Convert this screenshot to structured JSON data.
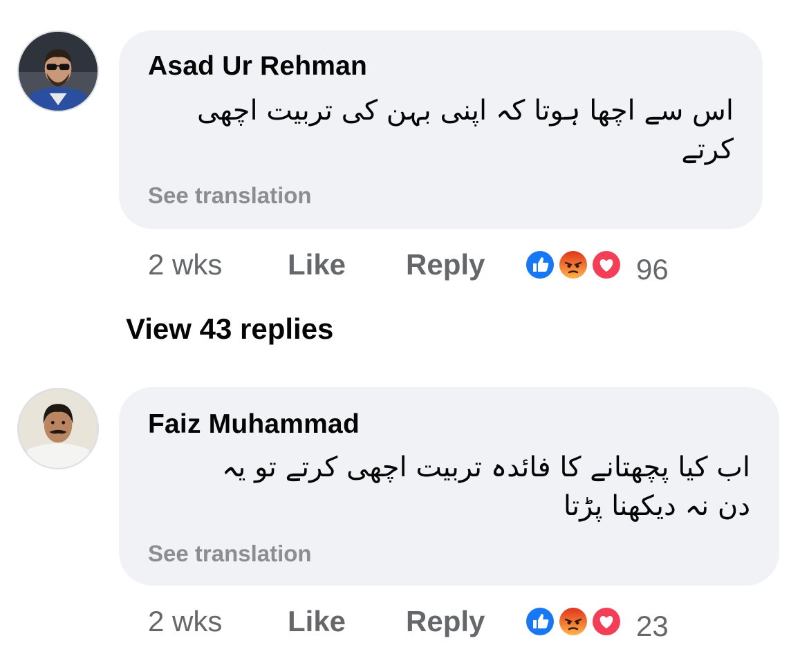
{
  "comments": [
    {
      "author": "Asad Ur Rehman",
      "text": "اس سے اچھا ہوتا کہ اپنی بہن کی تربیت اچھی\nکرتے",
      "see_translation": "See translation",
      "time": "2 wks",
      "like_label": "Like",
      "reply_label": "Reply",
      "reaction_count": "96",
      "reactions": [
        "like-icon",
        "angry-icon",
        "love-icon"
      ]
    },
    {
      "author": "Faiz Muhammad",
      "text": "اب کیا پچھتانے کا فائدہ تربیت اچھی کرتے تو یہ\nدن نہ دیکھنا پڑتا",
      "see_translation": "See translation",
      "time": "2 wks",
      "like_label": "Like",
      "reply_label": "Reply",
      "reaction_count": "23",
      "reactions": [
        "like-icon",
        "angry-icon",
        "love-icon"
      ]
    }
  ],
  "view_replies_label": "View 43 replies",
  "colors": {
    "bubble": "#f0f2f5",
    "like_blue": "#1877f2",
    "angry_orange": "#f15a24",
    "love_red": "#f33e58",
    "meta_gray": "#65676b"
  }
}
